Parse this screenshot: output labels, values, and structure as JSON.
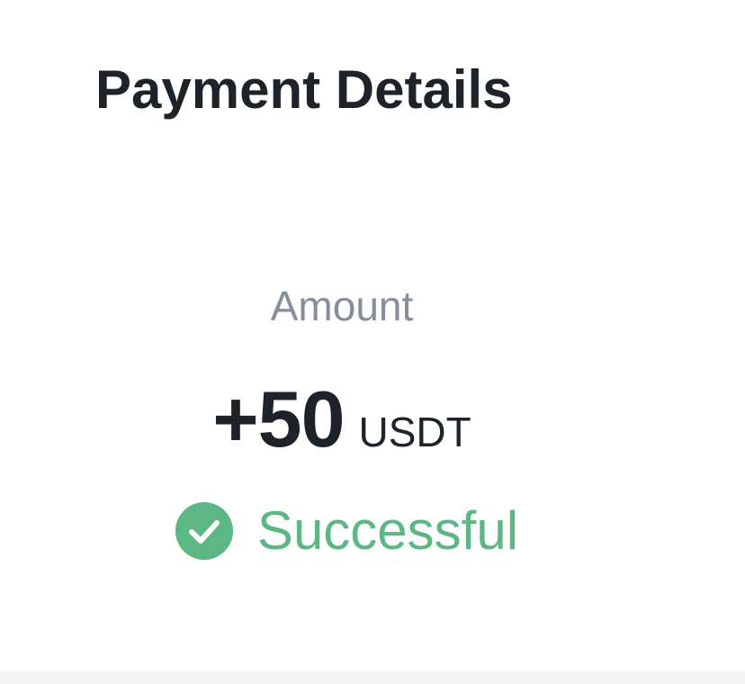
{
  "header": {
    "title": "Payment Details"
  },
  "amount": {
    "label": "Amount",
    "value": "+50",
    "currency": "USDT"
  },
  "status": {
    "text": "Successful",
    "icon": "check-circle-icon",
    "color": "#5cb784"
  },
  "colors": {
    "primary_text": "#1e2329",
    "secondary_text": "#848e9c",
    "success": "#5cb784"
  }
}
